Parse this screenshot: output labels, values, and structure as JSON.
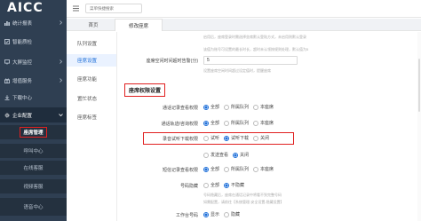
{
  "app": {
    "logo": "AICC"
  },
  "sidebar": {
    "items": [
      {
        "label": "统计报表",
        "icon": "chart-icon"
      },
      {
        "label": "智能质检",
        "icon": "check-icon"
      },
      {
        "label": "大屏监控",
        "icon": "monitor-icon"
      },
      {
        "label": "增值服务",
        "icon": "gift-icon"
      },
      {
        "label": "下载中心",
        "icon": "download-icon"
      },
      {
        "label": "企业配置",
        "icon": "gear-icon"
      }
    ],
    "sub_items": [
      "座席管理",
      "呼叫中心",
      "在线客服",
      "视频客服",
      "语音中心"
    ]
  },
  "topbar": {
    "search_placeholder": "菜单快捷搜索"
  },
  "tabs": {
    "home": "首页",
    "edit": "修改座席"
  },
  "submenu": {
    "items": [
      "队列设置",
      "座席设置",
      "座席功能",
      "置忙状态",
      "座席标签"
    ]
  },
  "content": {
    "hint_top": "启用后，座席登录时需选择坐席默认登陆方式，未启用则默认登录",
    "hint_top2": "该值为账号可设置的最长时长，超时未认领按规则处理，默认值为5",
    "timeout_label": "座席空闲时间超时告警(分)",
    "timeout_value": "5",
    "hint_timeout": "设置座席空闲时间超过设定值时，提醒座席",
    "section_title": "座席权限设置",
    "rows": [
      {
        "label": "通话记录查看权限",
        "options": [
          "全部",
          "所属队列",
          "本座席"
        ],
        "selected": 0
      },
      {
        "label": "通话轨迹/咨询权限",
        "options": [
          "全部",
          "所属队列",
          "本座席"
        ],
        "selected": 0
      },
      {
        "label": "录音试听下载权限",
        "options": [
          "试听",
          "试听下载",
          "关闭"
        ],
        "selected": 1
      },
      {
        "label": "",
        "options": [
          "发送查看",
          "关闭"
        ],
        "selected": 1
      },
      {
        "label": "短信记录查看权限",
        "options": [
          "全部",
          "所属队列",
          "本座席"
        ],
        "selected": 0
      },
      {
        "label": "号码隐藏",
        "options": [
          "全部",
          "不隐藏"
        ],
        "selected": 1
      },
      {
        "label": "工作台号码",
        "options": [
          "显示",
          "隐藏"
        ],
        "selected": 0
      }
    ],
    "hint_hide": "号码隐藏后，座席在通话记录中将看不到完整号码",
    "hint_hide2": "如需配置，请前往【系统管理-安全设置-隐藏设置】"
  },
  "colors": {
    "sidebar": "#2f3f52",
    "accent": "#1e6fd9",
    "highlight": "#e02020"
  }
}
